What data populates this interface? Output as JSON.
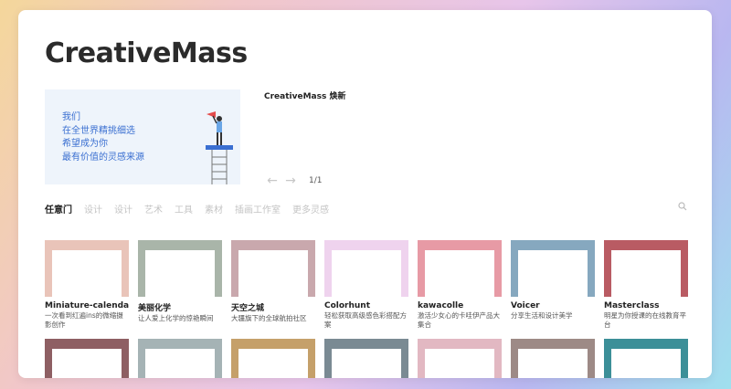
{
  "brand": "CreativeMass",
  "banner": {
    "lines": [
      "我们",
      "在全世界精挑细选",
      "希望成为你",
      "最有价值的灵感来源"
    ]
  },
  "featured": {
    "title": "CreativeMass 焕新",
    "page": "1/1",
    "prev_icon": "arrow-left-icon",
    "next_icon": "arrow-right-icon"
  },
  "tabs": [
    "任意门",
    "设计",
    "设计",
    "艺术",
    "工具",
    "素材",
    "插画工作室",
    "更多灵感"
  ],
  "search_icon": "search-icon",
  "colors": {
    "accent": "#3a6fd1",
    "text": "#222222",
    "muted": "#c4c4c4"
  },
  "sites": [
    {
      "name": "Miniature-calendar",
      "desc": "一次看到红遍ins的微缩摄影创作",
      "color": "#e9c4b9"
    },
    {
      "name": "美丽化学",
      "desc": "让人爱上化学的惊艳瞬间",
      "color": "#a9b5a9"
    },
    {
      "name": "天空之城",
      "desc": "大疆旗下的全球航拍社区",
      "color": "#c9a8ad"
    },
    {
      "name": "Colorhunt",
      "desc": "轻松获取高级感色彩搭配方案",
      "color": "#efd3ee"
    },
    {
      "name": "kawacolle",
      "desc": "激活少女心的卡哇伊产品大集合",
      "color": "#e79aa5"
    },
    {
      "name": "Voicer",
      "desc": "分享生活和设计美学",
      "color": "#86a8bf"
    },
    {
      "name": "Masterclass",
      "desc": "明星为你授课的在线教育平台",
      "color": "#b95b63"
    }
  ],
  "sites_row2": [
    {
      "color": "#8e5f63"
    },
    {
      "color": "#a5b3b5"
    },
    {
      "color": "#c5a06a"
    },
    {
      "color": "#7a8a93"
    },
    {
      "color": "#e2b8c2"
    },
    {
      "color": "#9d8a86"
    },
    {
      "color": "#3c8f98"
    }
  ]
}
